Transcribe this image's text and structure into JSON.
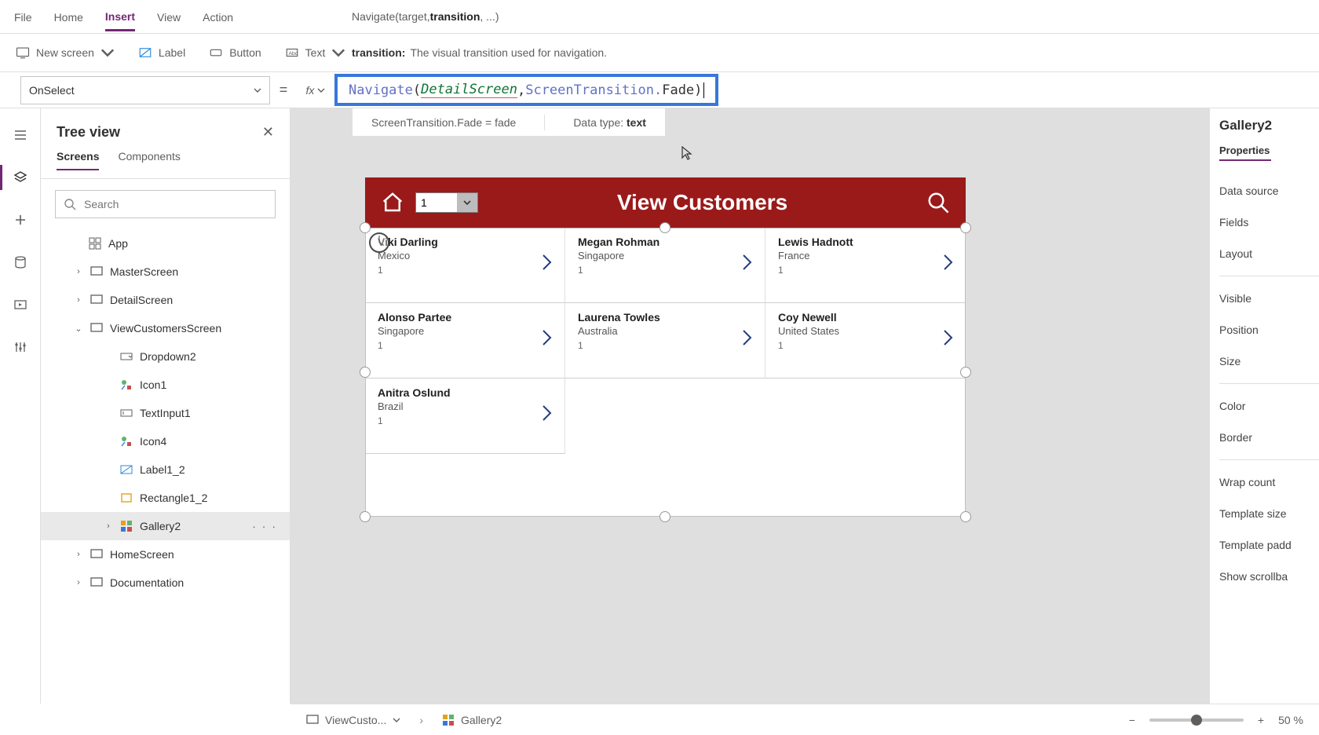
{
  "tabs": {
    "file": "File",
    "home": "Home",
    "insert": "Insert",
    "view": "View",
    "action": "Action",
    "active": "Insert"
  },
  "signature": {
    "prefix": "Navigate(target, ",
    "bold": "transition",
    "suffix": ", ...)"
  },
  "paramTip": {
    "name": "transition:",
    "desc": "The visual transition used for navigation."
  },
  "ribbon": {
    "newScreen": "New screen",
    "label": "Label",
    "button": "Button",
    "text": "Text"
  },
  "property": "OnSelect",
  "formula": {
    "fn": "Navigate",
    "open": "(",
    "arg": "DetailScreen",
    "comma": ", ",
    "st": "ScreenTransition.",
    "fade": "Fade",
    "close": ")"
  },
  "resultBar": {
    "left": "ScreenTransition.Fade  =  fade",
    "rightLabel": "Data type: ",
    "rightValue": "text"
  },
  "treePanel": {
    "title": "Tree view",
    "tab1": "Screens",
    "tab2": "Components",
    "searchPlaceholder": "Search",
    "app": "App",
    "nodes": [
      {
        "name": "MasterScreen",
        "lvl": 1,
        "chev": ">",
        "icon": "screen"
      },
      {
        "name": "DetailScreen",
        "lvl": 1,
        "chev": ">",
        "icon": "screen"
      },
      {
        "name": "ViewCustomersScreen",
        "lvl": 1,
        "chev": "v",
        "icon": "screen"
      },
      {
        "name": "Dropdown2",
        "lvl": 2,
        "icon": "dropdown"
      },
      {
        "name": "Icon1",
        "lvl": 2,
        "icon": "iconctl"
      },
      {
        "name": "TextInput1",
        "lvl": 2,
        "icon": "textinput"
      },
      {
        "name": "Icon4",
        "lvl": 2,
        "icon": "iconctl"
      },
      {
        "name": "Label1_2",
        "lvl": 2,
        "icon": "label"
      },
      {
        "name": "Rectangle1_2",
        "lvl": 2,
        "icon": "rect"
      },
      {
        "name": "Gallery2",
        "lvl": 2,
        "chev": ">",
        "icon": "gallery",
        "selected": true,
        "more": "· · ·"
      },
      {
        "name": "HomeScreen",
        "lvl": 1,
        "chev": ">",
        "icon": "screen"
      },
      {
        "name": "Documentation",
        "lvl": 1,
        "chev": ">",
        "icon": "screen"
      }
    ]
  },
  "app": {
    "title": "View Customers",
    "ddValue": "1"
  },
  "customers": [
    {
      "name": "Viki  Darling",
      "country": "Mexico",
      "num": "1"
    },
    {
      "name": "Megan  Rohman",
      "country": "Singapore",
      "num": "1"
    },
    {
      "name": "Lewis  Hadnott",
      "country": "France",
      "num": "1"
    },
    {
      "name": "Alonso  Partee",
      "country": "Singapore",
      "num": "1"
    },
    {
      "name": "Laurena  Towles",
      "country": "Australia",
      "num": "1"
    },
    {
      "name": "Coy  Newell",
      "country": "United States",
      "num": "1"
    },
    {
      "name": "Anitra  Oslund",
      "country": "Brazil",
      "num": "1"
    }
  ],
  "props": {
    "heading": "Gallery2",
    "tab": "Properties",
    "items": [
      "Data source",
      "Fields",
      "Layout",
      "Visible",
      "Position",
      "Size",
      "Color",
      "Border",
      "Wrap count",
      "Template size",
      "Template padd",
      "Show scrollba"
    ]
  },
  "status": {
    "crumb1": "ViewCusto...",
    "crumb2": "Gallery2",
    "zoom": "50 %"
  }
}
